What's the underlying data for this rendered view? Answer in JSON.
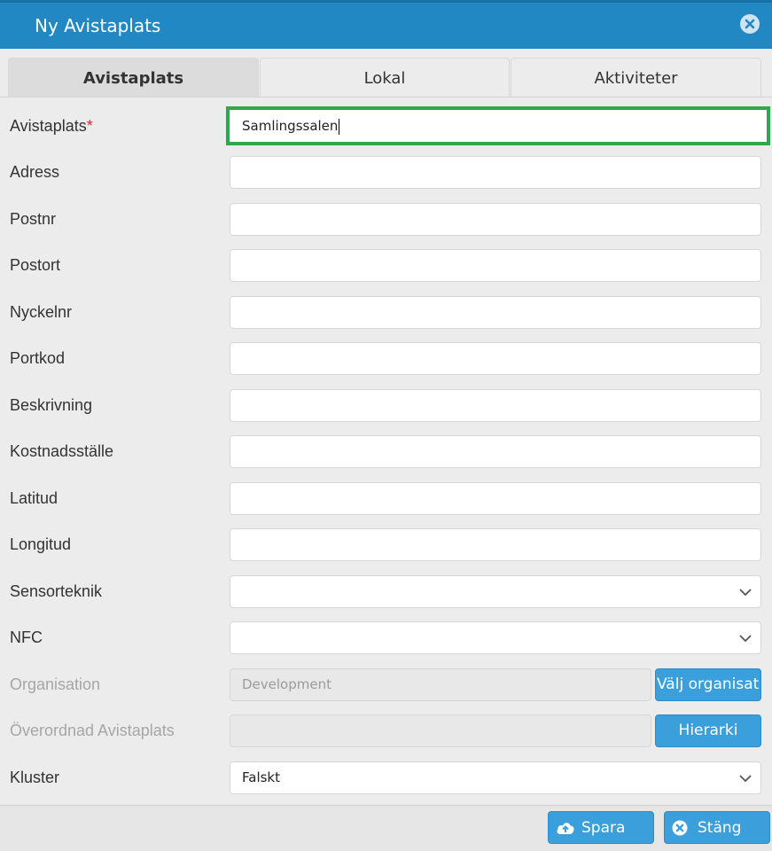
{
  "dialog": {
    "title": "Ny Avistaplats"
  },
  "tabs": [
    {
      "label": "Avistaplats",
      "active": true
    },
    {
      "label": "Lokal",
      "active": false
    },
    {
      "label": "Aktiviteter",
      "active": false
    }
  ],
  "fields": {
    "avistaplats": {
      "label": "Avistaplats",
      "required_mark": "*",
      "value": "Samlingssalen"
    },
    "adress": {
      "label": "Adress",
      "value": ""
    },
    "postnr": {
      "label": "Postnr",
      "value": ""
    },
    "postort": {
      "label": "Postort",
      "value": ""
    },
    "nyckelnr": {
      "label": "Nyckelnr",
      "value": ""
    },
    "portkod": {
      "label": "Portkod",
      "value": ""
    },
    "beskrivning": {
      "label": "Beskrivning",
      "value": ""
    },
    "kostnadsstalle": {
      "label": "Kostnadsställe",
      "value": ""
    },
    "latitud": {
      "label": "Latitud",
      "value": ""
    },
    "longitud": {
      "label": "Longitud",
      "value": ""
    },
    "sensorteknik": {
      "label": "Sensorteknik",
      "value": ""
    },
    "nfc": {
      "label": "NFC",
      "value": ""
    },
    "organisation": {
      "label": "Organisation",
      "value": "Development",
      "button": "Välj organisatio"
    },
    "overordnad": {
      "label": "Överordnad Avistaplats",
      "value": "",
      "button": "Hierarki"
    },
    "kluster": {
      "label": "Kluster",
      "value": "Falskt"
    }
  },
  "footer": {
    "save_label": "Spara",
    "close_label": "Stäng"
  },
  "colors": {
    "header": "#2188c4",
    "button": "#3a9fdb",
    "focus": "#2ea84a",
    "required": "#d9262c"
  }
}
